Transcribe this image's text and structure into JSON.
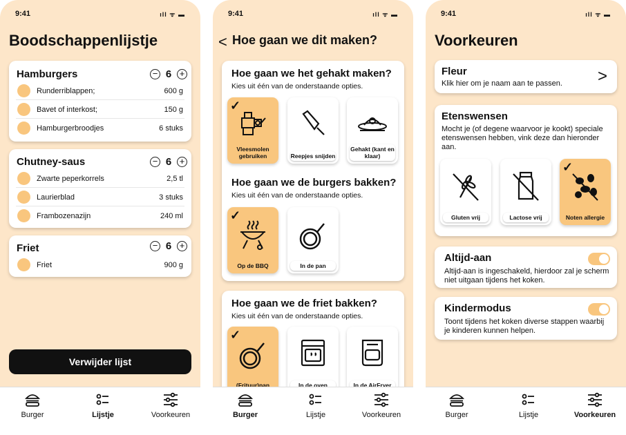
{
  "status": {
    "time": "9:41",
    "icons": "ıll ᯤ ▬"
  },
  "screen1": {
    "title": "Boodschappenlijstje",
    "groups": [
      {
        "name": "Hamburgers",
        "count": "6",
        "items": [
          {
            "name": "Runderriblappen;",
            "qty": "600 g"
          },
          {
            "name": "Bavet of interkost;",
            "qty": "150 g"
          },
          {
            "name": "Hamburgerbroodjes",
            "qty": "6 stuks"
          }
        ]
      },
      {
        "name": "Chutney-saus",
        "count": "6",
        "items": [
          {
            "name": "Zwarte peperkorrels",
            "qty": "2,5 tl"
          },
          {
            "name": "Laurierblad",
            "qty": "3 stuks"
          },
          {
            "name": "Frambozenazijn",
            "qty": "240 ml"
          }
        ]
      },
      {
        "name": "Friet",
        "count": "6",
        "items": [
          {
            "name": "Friet",
            "qty": "900 g"
          }
        ]
      }
    ],
    "delete_label": "Verwijder lijst"
  },
  "screen2": {
    "title": "Hoe gaan we dit maken?",
    "back": "<",
    "sections": [
      {
        "title": "Hoe gaan we het gehakt maken?",
        "sub": "Kies uit één van de onderstaande opties.",
        "options": [
          "Vleesmolen gebruiken",
          "Reepjes snijden",
          "Gehakt (kant en klaar)"
        ]
      },
      {
        "title": "Hoe gaan we de burgers bakken?",
        "sub": "Kies uit één van de onderstaande opties.",
        "options": [
          "Op de BBQ",
          "In de pan"
        ]
      },
      {
        "title": "Hoe gaan we de friet bakken?",
        "sub": "Kies uit één van de onderstaande opties.",
        "options": [
          "(Frituur)pan",
          "In de oven",
          "In de AirFryer"
        ]
      }
    ]
  },
  "screen3": {
    "title": "Voorkeuren",
    "profile": {
      "name": "Fleur",
      "sub": "Klik hier om je naam aan te passen.",
      "chevron": ">"
    },
    "diet": {
      "title": "Etenswensen",
      "text": "Mocht je (of degene waarvoor je kookt) speciale etenswensen hebben, vink deze dan hieronder aan.",
      "options": [
        "Gluten vrij",
        "Lactose vrij",
        "Noten allergie"
      ]
    },
    "always_on": {
      "title": "Altijd-aan",
      "text": "Altijd-aan is ingeschakeld, hierdoor zal je scherm niet uitgaan tijdens het koken.",
      "on": true
    },
    "kids": {
      "title": "Kindermodus",
      "text": "Toont tijdens het koken diverse stappen waarbij je kinderen kunnen helpen.",
      "on": true
    }
  },
  "nav": {
    "burger": "Burger",
    "list": "Lijstje",
    "prefs": "Voorkeuren"
  },
  "colors": {
    "background": "#fde6c9",
    "accent": "#f9c67e",
    "dark": "#111111"
  },
  "checkmark": "✓",
  "icons": [
    "burger-icon",
    "list-icon",
    "sliders-icon",
    "meat-grinder-icon",
    "cleaver-icon",
    "mince-plate-icon",
    "bbq-grill-icon",
    "pan-icon",
    "oven-icon",
    "airfryer-icon",
    "wheat-crossed-icon",
    "milk-crossed-icon",
    "nuts-icon"
  ]
}
